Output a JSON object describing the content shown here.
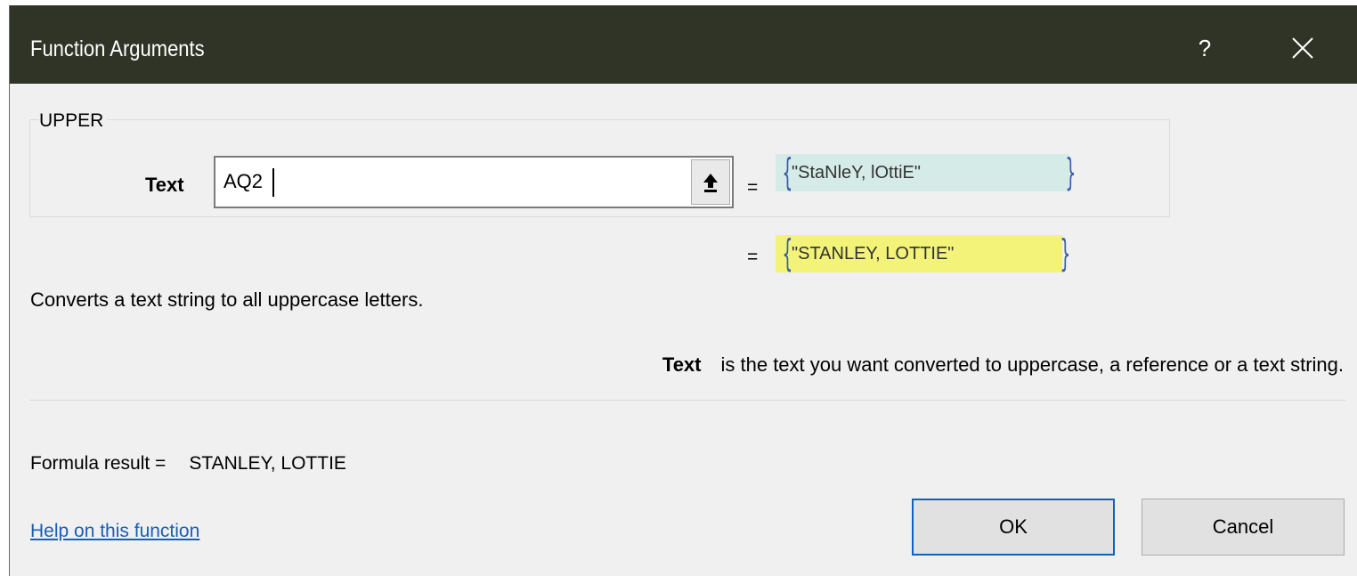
{
  "window": {
    "title": "Function Arguments",
    "help_label": "?",
    "close_label": "close"
  },
  "function": {
    "name": "UPPER",
    "argument_label": "Text",
    "argument_value": "AQ2",
    "argument_evaluated": "\"StaNleY, lOttiE\"",
    "argument_evaluated_color": "#d5ebe7",
    "result_preview": "\"STANLEY, LOTTIE\"",
    "result_preview_color": "#f3f37a",
    "equals_sign": "=",
    "description": "Converts a text string to all uppercase letters.",
    "arg_help_name": "Text",
    "arg_help_text": "is the text you want converted to uppercase, a reference or a text string."
  },
  "footer": {
    "formula_result_label": "Formula result =",
    "formula_result_value": "STANLEY, LOTTIE",
    "help_link": "Help on this function",
    "ok_label": "OK",
    "cancel_label": "Cancel"
  },
  "icons": {
    "close": "close-icon",
    "collapse": "collapse-dialog-icon"
  },
  "colors": {
    "titlebar": "#2f3426",
    "dialog_bg": "#f0f0f0",
    "ok_border": "#0a64c8",
    "link": "#1a5fb4"
  }
}
